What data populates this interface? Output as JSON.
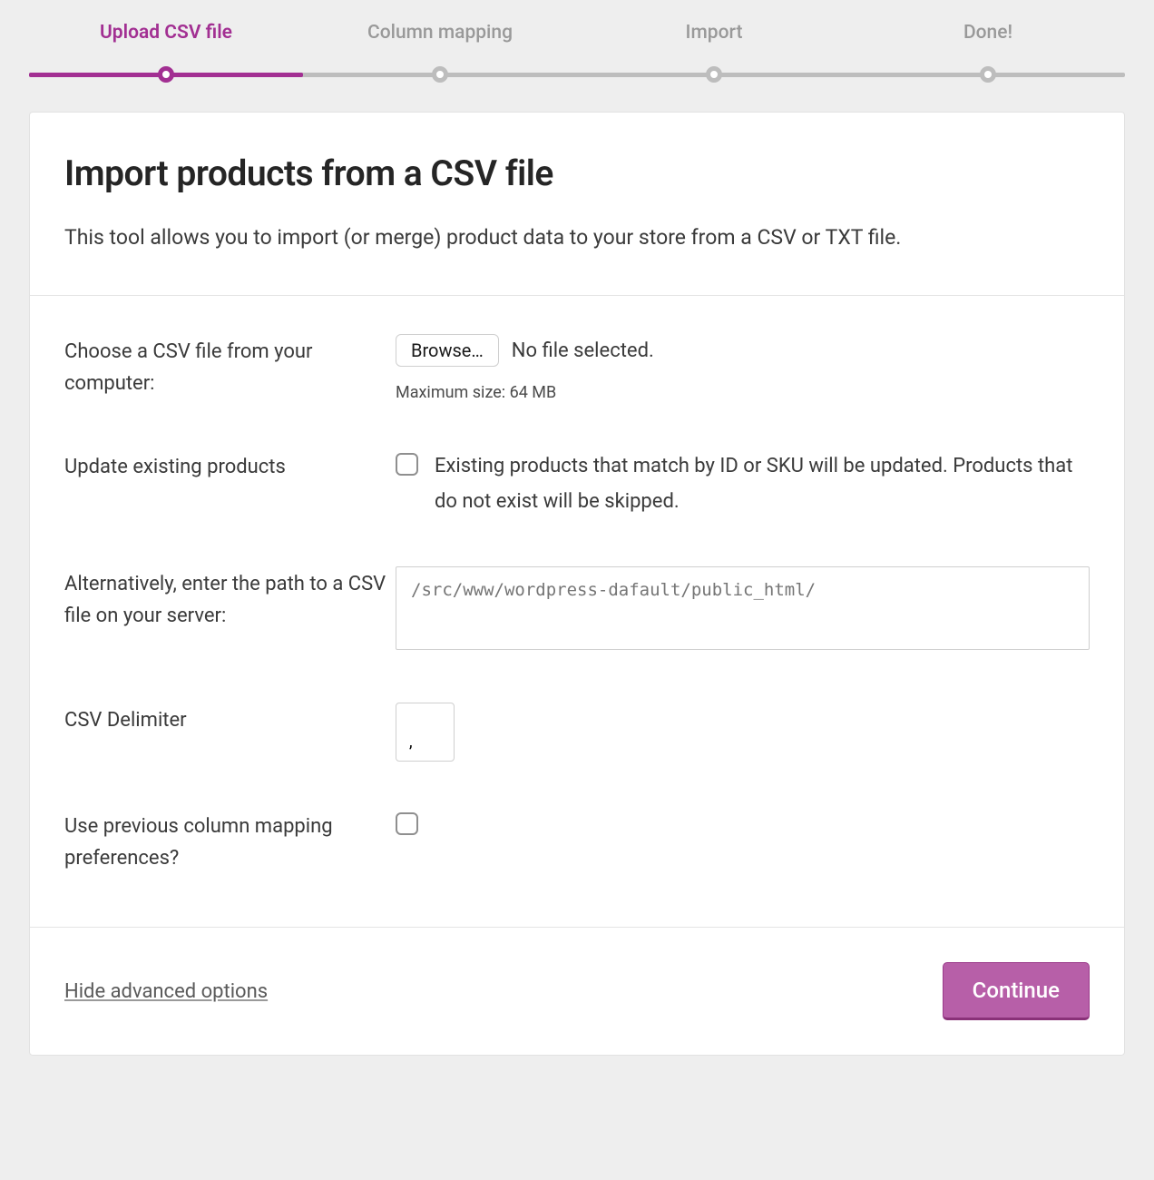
{
  "steps": [
    {
      "label": "Upload CSV file",
      "active": true
    },
    {
      "label": "Column mapping",
      "active": false
    },
    {
      "label": "Import",
      "active": false
    },
    {
      "label": "Done!",
      "active": false
    }
  ],
  "header": {
    "title": "Import products from a CSV file",
    "description": "This tool allows you to import (or merge) product data to your store from a CSV or TXT file."
  },
  "fields": {
    "choose_file": {
      "label": "Choose a CSV file from your computer:",
      "browse_label": "Browse…",
      "status": "No file selected.",
      "maxsize": "Maximum size: 64 MB"
    },
    "update_existing": {
      "label": "Update existing products",
      "checked": false,
      "description": "Existing products that match by ID or SKU will be updated. Products that do not exist will be skipped."
    },
    "server_path": {
      "label": "Alternatively, enter the path to a CSV file on your server:",
      "placeholder": "/src/www/wordpress-dafault/public_html/",
      "value": ""
    },
    "delimiter": {
      "label": "CSV Delimiter",
      "value": ","
    },
    "previous_mapping": {
      "label": "Use previous column mapping preferences?",
      "checked": false
    }
  },
  "footer": {
    "advanced_link": "Hide advanced options",
    "continue_label": "Continue"
  },
  "colors": {
    "accent": "#a22f92"
  }
}
